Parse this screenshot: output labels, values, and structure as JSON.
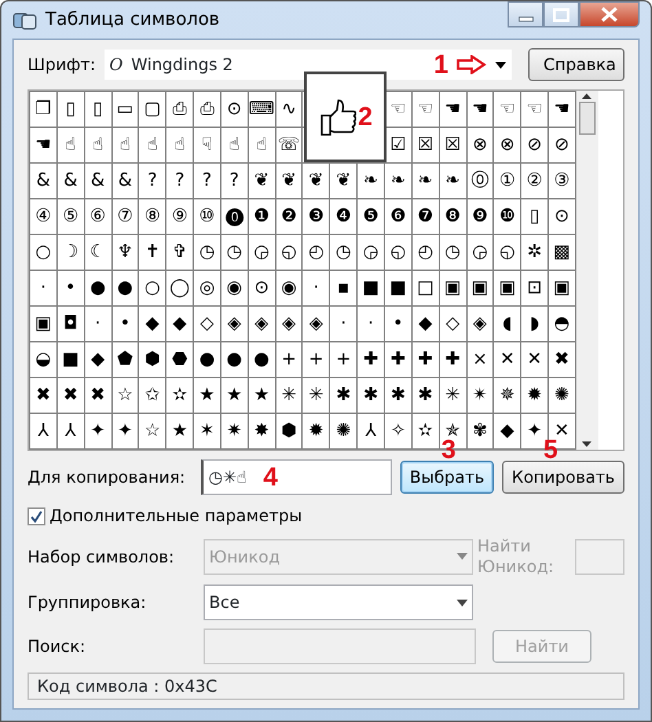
{
  "window": {
    "title": "Таблица символов"
  },
  "font": {
    "label": "Шрифт:",
    "icon": "O",
    "value": "Wingdings 2",
    "annotation": "1"
  },
  "help_button": "Справка",
  "grid": {
    "rows": [
      [
        "❐",
        "▯",
        "▯",
        "▭",
        "▢",
        "⎙",
        "⎙",
        "⊙",
        "⌨",
        "∿",
        null,
        null,
        null,
        "☜",
        "☜",
        "☚",
        "☚",
        "☜",
        "☜",
        "☚"
      ],
      [
        "☚",
        "☝",
        "☝",
        "☝",
        "☝",
        "☝",
        "☟",
        "☝",
        "☝",
        "☏",
        null,
        null,
        null,
        "☑",
        "☒",
        "☒",
        "⊗",
        "⊗",
        "⊘",
        "⊘"
      ],
      [
        "&",
        "&",
        "&",
        "&",
        "?",
        "?",
        "?",
        "?",
        "❦",
        "❦",
        "❦",
        "❦",
        "❧",
        "❧",
        "❧",
        "❧",
        "⓪",
        "①",
        "②",
        "③"
      ],
      [
        "④",
        "⑤",
        "⑥",
        "⑦",
        "⑧",
        "⑨",
        "⑩",
        "⓿",
        "❶",
        "❷",
        "❸",
        "❹",
        "❺",
        "❻",
        "❼",
        "❽",
        "❾",
        "❿",
        "▯",
        "⊙"
      ],
      [
        "○",
        "☽",
        "☾",
        "♆",
        "✝",
        "✞",
        "◷",
        "◷",
        "◶",
        "◵",
        "◴",
        "◷",
        "◶",
        "◵",
        "◴",
        "◷",
        "◶",
        "◵",
        "✲",
        "▩"
      ],
      [
        "·",
        "•",
        "●",
        "●",
        "○",
        "◯",
        "◎",
        "◉",
        "⊙",
        "◉",
        "·",
        "▪",
        "■",
        "■",
        "□",
        "▣",
        "▣",
        "▣",
        "⊡",
        "▣"
      ],
      [
        "▣",
        "◘",
        "·",
        "•",
        "◆",
        "◆",
        "◇",
        "◈",
        "◈",
        "◈",
        "◈",
        "·",
        "·",
        "•",
        "◆",
        "◇",
        "◈",
        "◖",
        "◗",
        "◓"
      ],
      [
        "◒",
        "■",
        "◆",
        "⬟",
        "⬢",
        "⬣",
        "●",
        "●",
        "●",
        "+",
        "+",
        "+",
        "✚",
        "✚",
        "✚",
        "✚",
        "×",
        "✕",
        "✕",
        "✖"
      ],
      [
        "✖",
        "✖",
        "✖",
        "☆",
        "✩",
        "✫",
        "★",
        "★",
        "★",
        "✳",
        "✳",
        "✱",
        "✱",
        "✱",
        "✱",
        "✳",
        "✴",
        "✵",
        "✹",
        "✺"
      ],
      [
        "⅄",
        "⅄",
        "✦",
        "✦",
        "☆",
        "★",
        "✶",
        "✷",
        "✸",
        "⬢",
        "✹",
        "✺",
        "⅄",
        "✧",
        "✫",
        "✯",
        "✾",
        "◆",
        "✦",
        "✕"
      ]
    ]
  },
  "preview": {
    "annotation": "2"
  },
  "copy_field": {
    "label": "Для копирования:",
    "value": "◷✳☝",
    "annotation": "4"
  },
  "select_button": {
    "label": "Выбрать",
    "annotation": "3",
    "focused": true
  },
  "copy_button": {
    "label": "Копировать",
    "annotation": "5"
  },
  "advanced": {
    "label": "Дополнительные параметры",
    "checked": true
  },
  "charset": {
    "label": "Набор символов:",
    "value": "Юникод",
    "disabled": true
  },
  "find_unicode": {
    "label": "Найти Юникод:",
    "disabled": true
  },
  "grouping": {
    "label": "Группировка:",
    "value": "Все",
    "disabled": false
  },
  "search": {
    "label": "Поиск:",
    "disabled": true,
    "button": "Найти"
  },
  "status_bar": "Код символа : 0x43C"
}
